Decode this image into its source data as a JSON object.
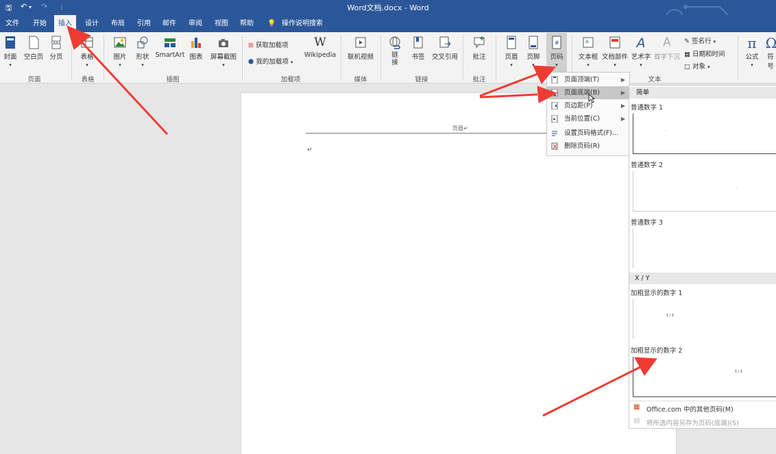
{
  "window": {
    "title": "Word文档.docx  -  Word"
  },
  "tabs": [
    {
      "label": "文件"
    },
    {
      "label": "开始"
    },
    {
      "label": "插入"
    },
    {
      "label": "设计"
    },
    {
      "label": "布局"
    },
    {
      "label": "引用"
    },
    {
      "label": "邮件"
    },
    {
      "label": "审阅"
    },
    {
      "label": "视图"
    },
    {
      "label": "帮助"
    }
  ],
  "search_hint": "操作说明搜索",
  "ribbon": {
    "pages": {
      "cover": "封面",
      "blank": "空白页",
      "break": "分页",
      "group": "页面"
    },
    "table": {
      "label": "表格",
      "group": "表格"
    },
    "illus": {
      "picture": "图片",
      "shapes": "形状",
      "smartart": "SmartArt",
      "chart": "图表",
      "screenshot": "屏幕截图",
      "group": "插图"
    },
    "addins": {
      "get": "获取加载项",
      "mine": "我的加载项",
      "wiki": "Wikipedia",
      "group": "加载项"
    },
    "media": {
      "video": "联机视频",
      "group": "媒体"
    },
    "links": {
      "link": "链接",
      "bookmark": "书签",
      "crossref": "交叉引用",
      "group": "链接"
    },
    "comments": {
      "comment": "批注",
      "group": "批注"
    },
    "hf": {
      "header": "页眉",
      "footer": "页脚",
      "pagenum": "页码"
    },
    "text": {
      "textbox": "文本框",
      "parts": "文档部件",
      "wordart": "艺术字",
      "dropcap": "首字下沉",
      "signature": "签名行",
      "datetime": "日期和时间",
      "object": "对象",
      "group": "文本"
    },
    "symbols": {
      "equation": "公式",
      "symbol": "符号"
    }
  },
  "document": {
    "header_text": "页眉↵",
    "para_mark": "↵"
  },
  "menu": [
    {
      "label": "页面顶端(T)"
    },
    {
      "label": "页面底端(B)"
    },
    {
      "label": "页边距(P)"
    },
    {
      "label": "当前位置(C)"
    },
    {
      "label": "设置页码格式(F)..."
    },
    {
      "label": "删除页码(R)"
    }
  ],
  "gallery": {
    "section1": "简单",
    "items1": [
      {
        "name": "普通数字 1"
      },
      {
        "name": "普通数字 2"
      },
      {
        "name": "普通数字 3"
      }
    ],
    "section2": "X / Y",
    "items2": [
      {
        "name": "加粗显示的数字 1",
        "num": "1 / 1"
      },
      {
        "name": "加粗显示的数字 2",
        "num": "1 / 1"
      }
    ],
    "more": "Office.com 中的其他页码(M)",
    "save": "将所选内容另存为页码(底端)(S)"
  },
  "colors": {
    "brand": "#2b579a",
    "arrow": "#ef3b32"
  }
}
